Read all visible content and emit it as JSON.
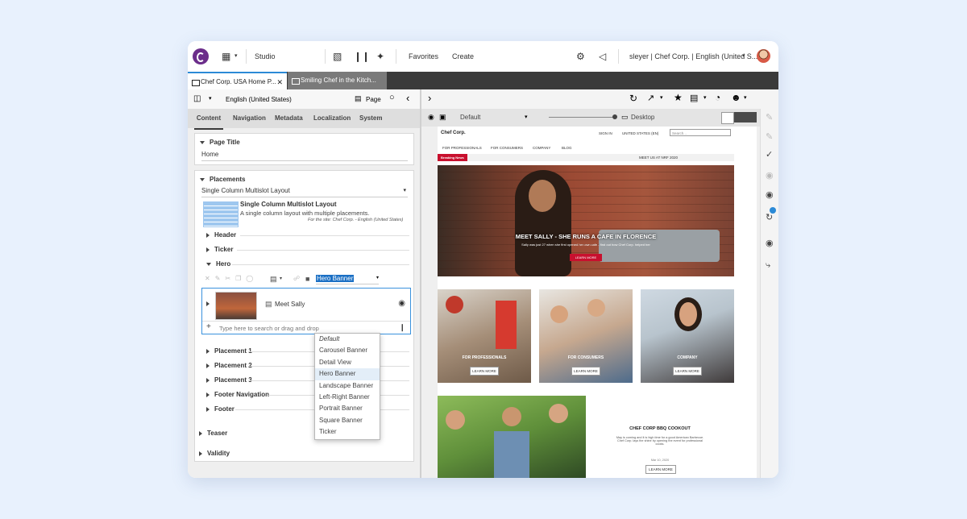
{
  "topbar": {
    "studio_label": "Studio",
    "favorites_label": "Favorites",
    "create_label": "Create",
    "user_label": "sleyer | Chef Corp. | English (United S..."
  },
  "tabs": [
    {
      "label": "Chef Corp. USA Home P...",
      "active": true
    },
    {
      "label": "Smiling Chef in the Kitch...",
      "active": false
    }
  ],
  "left": {
    "locale": "English (United States)",
    "page_label": "Page",
    "content_tabs": [
      "Content",
      "Navigation",
      "Metadata",
      "Localization",
      "System"
    ],
    "page_title_header": "Page Title",
    "page_title_value": "Home",
    "placements_header": "Placements",
    "layout_select": "Single Column Multislot Layout",
    "layout_name": "Single Column Multislot Layout",
    "layout_desc": "A single column layout with multiple placements.",
    "layout_site": "For the site: Chef Corp. - English (United States)",
    "slots_top": [
      "Header",
      "Ticker",
      "Hero"
    ],
    "view_select": "Hero Banner",
    "item_name": "Meet Sally",
    "search_placeholder": "Type here to search or drag and drop",
    "slots_bottom": [
      "Placement 1",
      "Placement 2",
      "Placement 3",
      "Footer Navigation",
      "Footer"
    ],
    "teaser_header": "Teaser",
    "validity_header": "Validity"
  },
  "dropdown": {
    "options": [
      "Default",
      "Carousel Banner",
      "Detail View",
      "Hero Banner",
      "Landscape Banner",
      "Left-Right Banner",
      "Portrait Banner",
      "Square Banner",
      "Ticker"
    ],
    "highlighted_index": 3
  },
  "right": {
    "device_default": "Default",
    "device_label": "Desktop"
  },
  "preview": {
    "brand": "Chef Corp.",
    "sign_in": "SIGN IN",
    "country": "UNITED STATES (EN)",
    "search_placeholder": "Search...",
    "nav": [
      "FOR PROFESSIONALS",
      "FOR CONSUMERS",
      "COMPANY",
      "BLOG"
    ],
    "breaking_label": "Breaking News",
    "ticker_text": "MEET US AT NRF 2020",
    "hero_title": "MEET SALLY - SHE RUNS A CAFE IN FLORENCE",
    "hero_sub": "Sally was just 27 when she first opened her own cafe - find out how Chef Corp. helped her",
    "hero_btn": "LEARN MORE",
    "card1_title": "FOR PROFESSIONALS",
    "card2_title": "FOR CONSUMERS",
    "card3_title": "COMPANY",
    "card_btn": "LEARN MORE",
    "bbq_title": "CHEF CORP BBQ COOKOUT",
    "bbq_text": "May is coming and it is high time for a good American Barbecue. Chef Corp. lays the shine by opening the event for professional cooks.",
    "bbq_date": "Mar 10, 2020",
    "bbq_btn": "LEARN MORE"
  },
  "colors": {
    "accent": "#6b2d8a",
    "tab_accent": "#2c8ad6",
    "brand_red": "#c8102e"
  }
}
